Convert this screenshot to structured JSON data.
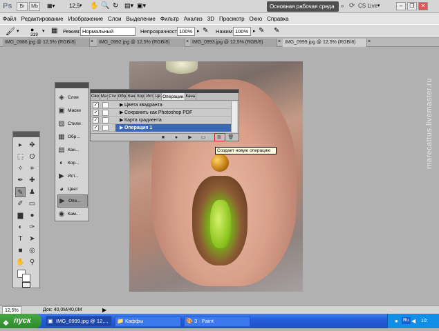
{
  "app": {
    "logo": "Ps",
    "zoom_value": "12,5",
    "workspace": "Основная рабочая среда",
    "cs_live": "CS Live"
  },
  "menu": [
    "Файл",
    "Редактирование",
    "Изображение",
    "Слои",
    "Выделение",
    "Фильтр",
    "Анализ",
    "3D",
    "Просмотр",
    "Окно",
    "Справка"
  ],
  "options": {
    "brush_size": "319",
    "mode_label": "Режим:",
    "mode_value": "Нормальный",
    "opacity_label": "Непрозрачность:",
    "opacity_value": "100%",
    "flow_label": "Нажим:",
    "flow_value": "100%"
  },
  "doc_tabs": [
    "IMG_0986.jpg @ 12,5% (RGB/8)",
    "IMG_0992.jpg @ 12,5% (RGB/8)",
    "IMG_0993.jpg @ 12,5% (RGB/8)",
    "IMG_0999.jpg @ 12,5% (RGB/8)"
  ],
  "mini_panels": [
    "Слои",
    "Маски",
    "Стили",
    "Обр...",
    "Кан...",
    "Кор...",
    "Ист...",
    "Цвет",
    "Опе...",
    "Кам..."
  ],
  "actions_panel": {
    "tabs": [
      "Сво",
      "Ма",
      "Сти",
      "Обр",
      "Кан",
      "Кор",
      "Ист",
      "Цв",
      "Операции",
      "Кана"
    ],
    "rows": [
      "Цвета квадранта",
      "Сохранить как Photoshop PDF",
      "Карта градиента",
      "Операция 1"
    ],
    "tooltip": "Создает новую операцию"
  },
  "statusbar": {
    "zoom": "12,5%",
    "doc": "Док: 40,0M/40,0M"
  },
  "taskbar": {
    "start": "пуск",
    "tasks": [
      "IMG_0999.jpg @ 12,...",
      "Каффы",
      "3 - Paint"
    ],
    "lang": "Ru",
    "time": "10:"
  },
  "watermark": "marecattus.livemaster.ru",
  "colors": {
    "accent": "#3a68b5",
    "taskbar": "#245edc",
    "highlight_ring": "#d42020"
  }
}
